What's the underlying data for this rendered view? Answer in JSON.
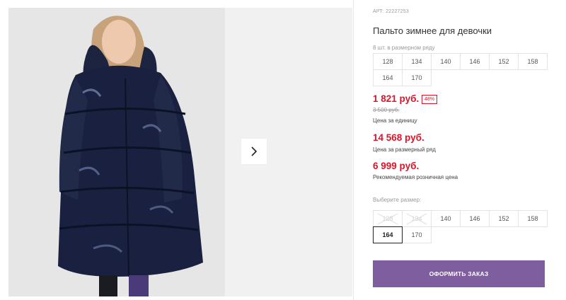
{
  "product": {
    "article": "АРТ: 22227253",
    "title": "Пальто зимнее для девочки",
    "row_note": "8 шт. в размерном ряду"
  },
  "row_sizes": [
    "128",
    "134",
    "140",
    "146",
    "152",
    "158",
    "164",
    "170"
  ],
  "pricing": {
    "unit_price": "1 821 руб.",
    "discount": "48%",
    "old_price": "3 500 руб.",
    "unit_caption": "Цена за единицу",
    "row_price": "14 568 руб.",
    "row_caption": "Цена за размерный ряд",
    "rrp_price": "6 999 руб.",
    "rrp_caption": "Рекомендуемая розничная цена"
  },
  "size_select": {
    "label": "Выберите размер:",
    "options": [
      {
        "size": "128",
        "available": false
      },
      {
        "size": "134",
        "available": false
      },
      {
        "size": "140",
        "available": true
      },
      {
        "size": "146",
        "available": true
      },
      {
        "size": "152",
        "available": true
      },
      {
        "size": "158",
        "available": true
      },
      {
        "size": "164",
        "available": true,
        "selected": true
      },
      {
        "size": "170",
        "available": true
      }
    ]
  },
  "actions": {
    "order_label": "ОФОРМИТЬ ЗАКАЗ"
  },
  "gallery": {
    "next_icon": "chevron-right-icon"
  },
  "colors": {
    "accent": "#7e5e9e",
    "price": "#d9162a"
  }
}
